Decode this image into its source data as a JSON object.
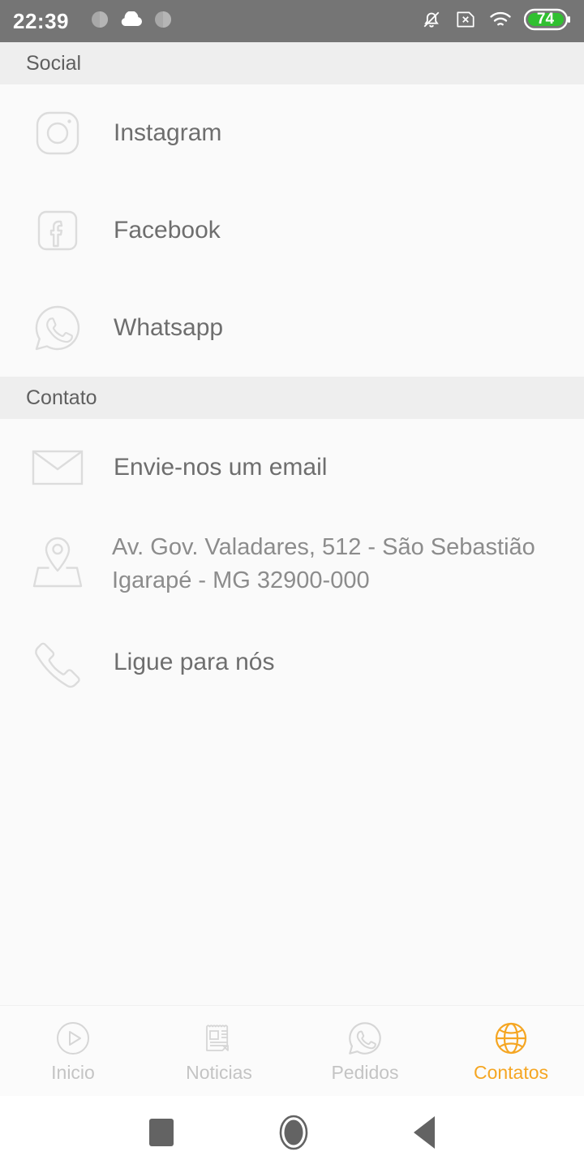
{
  "statusbar": {
    "time": "22:39",
    "left_icons": [
      "notification-dot-icon",
      "cloud-icon",
      "notification-dot-icon"
    ],
    "right_icons": [
      "bell-muted-icon",
      "sim-card-x-icon",
      "wifi-icon"
    ],
    "battery_percent": "74",
    "battery_color": "#30c030",
    "background": "#757575"
  },
  "sections": [
    {
      "title": "Social",
      "rows": [
        {
          "label": "Instagram",
          "icon": "instagram-icon"
        },
        {
          "label": "Facebook",
          "icon": "facebook-icon"
        },
        {
          "label": "Whatsapp",
          "icon": "whatsapp-icon"
        }
      ]
    },
    {
      "title": "Contato",
      "rows": [
        {
          "label": "Envie-nos um email",
          "icon": "envelope-icon"
        },
        {
          "label": "Av. Gov. Valadares, 512 - São Sebastião Igarapé - MG 32900-000",
          "icon": "map-pin-icon"
        },
        {
          "label": "Ligue para nós",
          "icon": "phone-icon"
        }
      ]
    }
  ],
  "tabbar": {
    "accent_color": "#f5a623",
    "inactive_color": "#c4c4c4",
    "tabs": [
      {
        "label": "Inicio",
        "icon": "play-circle-icon",
        "active": false
      },
      {
        "label": "Noticias",
        "icon": "newspaper-icon",
        "active": false
      },
      {
        "label": "Pedidos",
        "icon": "whatsapp-icon",
        "active": false
      },
      {
        "label": "Contatos",
        "icon": "globe-icon",
        "active": true
      }
    ]
  },
  "navbar": {
    "buttons": [
      {
        "icon": "recents-square-icon"
      },
      {
        "icon": "home-circle-icon"
      },
      {
        "icon": "back-triangle-icon"
      }
    ]
  }
}
